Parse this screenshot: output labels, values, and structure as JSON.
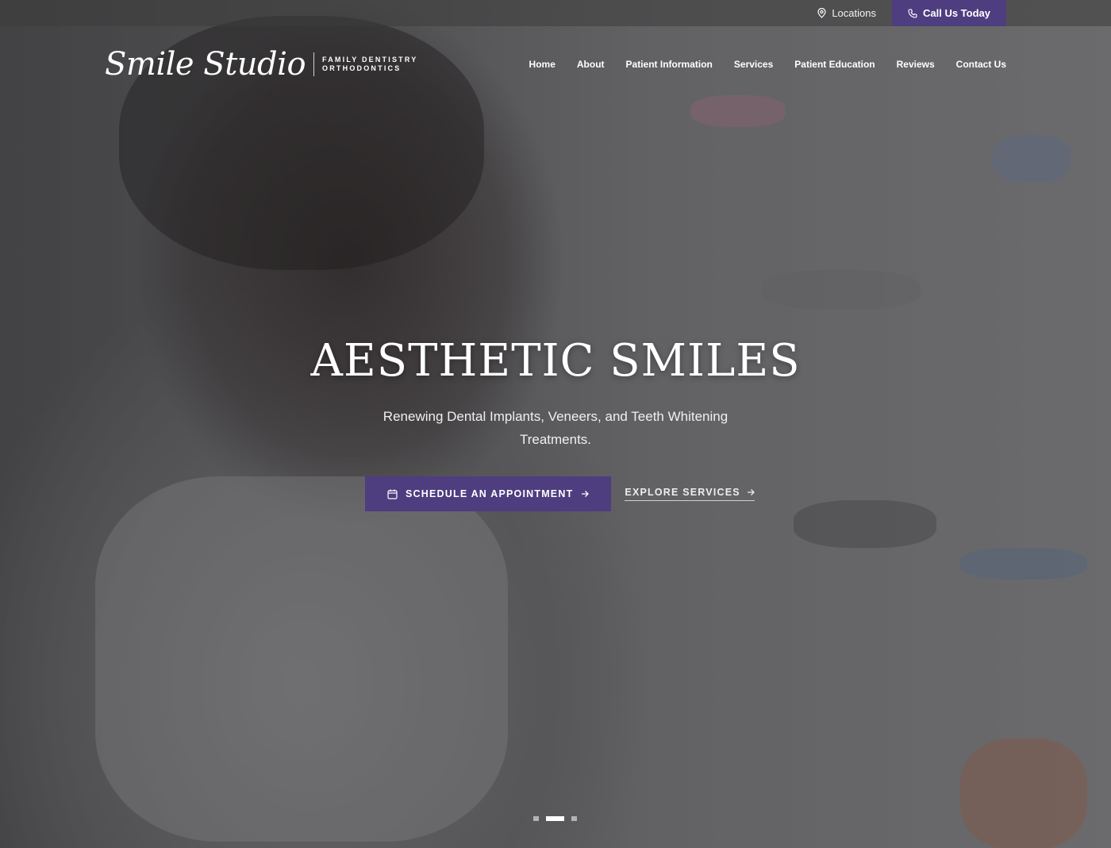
{
  "topbar": {
    "locations_label": "Locations",
    "call_label": "Call Us Today"
  },
  "logo": {
    "script": "Smile Studio",
    "tagline_line1": "FAMILY DENTISTRY",
    "tagline_line2": "ORTHODONTICS"
  },
  "nav": {
    "items": [
      "Home",
      "About",
      "Patient Information",
      "Services",
      "Patient Education",
      "Reviews",
      "Contact Us"
    ]
  },
  "hero": {
    "title": "AESTHETIC SMILES",
    "subtitle": "Renewing Dental Implants, Veneers, and Teeth Whitening Treatments.",
    "schedule_label": "SCHEDULE AN APPOINTMENT",
    "explore_label": "EXPLORE SERVICES"
  },
  "slider": {
    "total": 3,
    "active_index": 1
  },
  "colors": {
    "accent": "#4e3d7f"
  },
  "icons": {
    "locations": "map-pin-icon",
    "call": "phone-icon",
    "schedule": "calendar-icon",
    "arrow": "arrow-right-icon"
  }
}
